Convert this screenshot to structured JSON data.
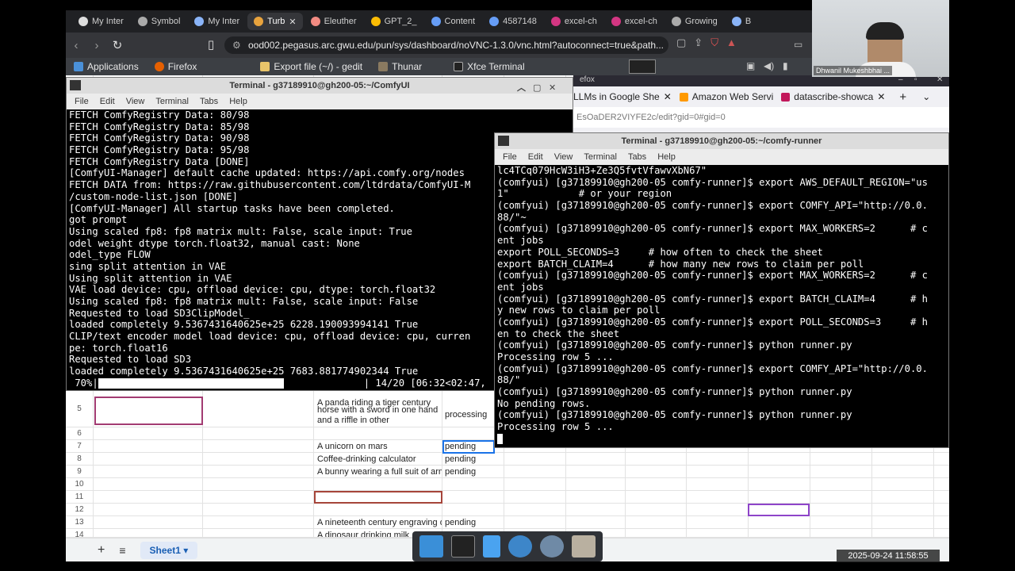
{
  "browser": {
    "tabs": [
      {
        "label": "My Inter",
        "icon": "github-icon"
      },
      {
        "label": "Symbol",
        "icon": "openai-icon"
      },
      {
        "label": "My Inter",
        "icon": "page-icon"
      },
      {
        "label": "Turb",
        "icon": "vnc-icon",
        "active": true
      },
      {
        "label": "Eleuther",
        "icon": "folder-icon"
      },
      {
        "label": "GPT_2_",
        "icon": "infinity-icon"
      },
      {
        "label": "Content",
        "icon": "app-icon"
      },
      {
        "label": "4587148",
        "icon": "app-icon"
      },
      {
        "label": "excel-ch",
        "icon": "sheets-icon"
      },
      {
        "label": "excel-ch",
        "icon": "sheets-icon"
      },
      {
        "label": "Growing",
        "icon": "openai-icon"
      },
      {
        "label": "B",
        "icon": "page-icon"
      }
    ],
    "url": "ood002.pegasus.arc.gwu.edu/pun/sys/dashboard/noVNC-1.3.0/vnc.html?autoconnect=true&path..."
  },
  "xfce_panel": {
    "items": [
      "Applications",
      "Firefox",
      "Export file (~/) - gedit",
      "Thunar",
      "Xfce Terminal"
    ]
  },
  "firefox": {
    "title": "efox",
    "tabs": [
      "LLMs in Google She",
      "Amazon Web Servi",
      "datascribe-showca"
    ],
    "url_fragment": "EsOaDER2VIYFE2c/edit?gid=0#gid=0"
  },
  "terminal1": {
    "title": "Terminal - g37189910@gh200-05:~/ComfyUI",
    "menu": [
      "File",
      "Edit",
      "View",
      "Terminal",
      "Tabs",
      "Help"
    ],
    "lines": [
      "FETCH ComfyRegistry Data: 80/98",
      "FETCH ComfyRegistry Data: 85/98",
      "FETCH ComfyRegistry Data: 90/98",
      "FETCH ComfyRegistry Data: 95/98",
      "FETCH ComfyRegistry Data [DONE]",
      "[ComfyUI-Manager] default cache updated: https://api.comfy.org/nodes",
      "FETCH DATA from: https://raw.githubusercontent.com/ltdrdata/ComfyUI-M",
      "/custom-node-list.json [DONE]",
      "[ComfyUI-Manager] All startup tasks have been completed.",
      "got prompt",
      "Using scaled fp8: fp8 matrix mult: False, scale input: True",
      "odel weight dtype torch.float32, manual cast: None",
      "odel_type FLOW",
      "sing split attention in VAE",
      "Using split attention in VAE",
      "VAE load device: cpu, offload device: cpu, dtype: torch.float32",
      "Using scaled fp8: fp8 matrix mult: False, scale input: False",
      "Requested to load SD3ClipModel_",
      "loaded completely 9.5367431640625e+25 6228.190093994141 True",
      "CLIP/text encoder model load device: cpu, offload device: cpu, curren",
      "pe: torch.float16",
      "Requested to load SD3",
      "loaded completely 9.5367431640625e+25 7683.881774902344 True"
    ],
    "progress_label": " 70%|",
    "progress_fraction": 0.7,
    "progress_tail": "| 14/20 [06:32<02:47,"
  },
  "terminal2": {
    "title": "Terminal - g37189910@gh200-05:~/comfy-runner",
    "menu": [
      "File",
      "Edit",
      "View",
      "Terminal",
      "Tabs",
      "Help"
    ],
    "lines": [
      "lc4TCq079HcW3iH3+Ze3Q5fvtVfawvXbN67\"",
      "(comfyui) [g37189910@gh200-05 comfy-runner]$ export AWS_DEFAULT_REGION=\"us",
      "1\"            # or your region",
      "(comfyui) [g37189910@gh200-05 comfy-runner]$ export COMFY_API=\"http://0.0.",
      "88/\"~",
      "(comfyui) [g37189910@gh200-05 comfy-runner]$ export MAX_WORKERS=2      # c",
      "ent jobs",
      "export POLL_SECONDS=3     # how often to check the sheet",
      "export BATCH_CLAIM=4      # how many new rows to claim per poll",
      "(comfyui) [g37189910@gh200-05 comfy-runner]$ export MAX_WORKERS=2      # c",
      "ent jobs",
      "(comfyui) [g37189910@gh200-05 comfy-runner]$ export BATCH_CLAIM=4      # h",
      "y new rows to claim per poll",
      "(comfyui) [g37189910@gh200-05 comfy-runner]$ export POLL_SECONDS=3     # h",
      "en to check the sheet",
      "(comfyui) [g37189910@gh200-05 comfy-runner]$ python runner.py",
      "Processing row 5 ...",
      "(comfyui) [g37189910@gh200-05 comfy-runner]$ export COMFY_API=\"http://0.0.",
      "88/\"",
      "(comfyui) [g37189910@gh200-05 comfy-runner]$ python runner.py",
      "No pending rows.",
      "(comfyui) [g37189910@gh200-05 comfy-runner]$ python runner.py",
      "Processing row 5 ..."
    ]
  },
  "sheet": {
    "rows": [
      {
        "num": "5",
        "prompt_lines": [
          "horse with a sword in one hand",
          "and a riffle in other"
        ],
        "status": "processing"
      },
      {
        "num": "6",
        "prompt": "",
        "status": ""
      },
      {
        "num": "7",
        "prompt": "A unicorn on mars",
        "status": "pending"
      },
      {
        "num": "8",
        "prompt": "Coffee-drinking calculator",
        "status": "pending"
      },
      {
        "num": "9",
        "prompt": "A bunny wearing a full suit of armo",
        "status": "pending"
      },
      {
        "num": "10",
        "prompt": "",
        "status": ""
      },
      {
        "num": "11",
        "prompt": "",
        "status": ""
      },
      {
        "num": "12",
        "prompt": "",
        "status": ""
      },
      {
        "num": "13",
        "prompt": "A nineteenth century engraving of",
        "status": "pending"
      },
      {
        "num": "14",
        "prompt": "A dinosaur drinking milk",
        "status": "pending"
      }
    ],
    "partial_top_text": "A panda riding a tiger century",
    "tab_name": "Sheet1"
  },
  "webcam": {
    "name": "Dhwanil Mukeshbhai ..."
  },
  "timestamp": "2025-09-24  11:58:55",
  "colors": {
    "terminal_bg": "#000000",
    "terminal_fg": "#ffffff",
    "selection_border": "#a23b72",
    "chrome_dark": "#202124"
  }
}
